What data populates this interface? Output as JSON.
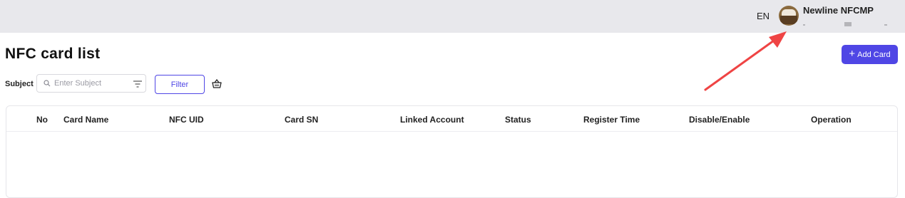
{
  "header": {
    "language": "EN",
    "user_name": "Newline NFCMP"
  },
  "page": {
    "title": "NFC card list",
    "add_button_label": "Add Card"
  },
  "filters": {
    "subject_label": "Subject",
    "search_placeholder": "Enter Subject",
    "filter_button_label": "Filter"
  },
  "table": {
    "columns": [
      "No",
      "Card Name",
      "NFC UID",
      "Card SN",
      "Linked Account",
      "Status",
      "Register Time",
      "Disable/Enable",
      "Operation"
    ],
    "rows": []
  },
  "colors": {
    "accent": "#4f46e5",
    "annotation_arrow": "#ef4444",
    "topbar": "#e8e8ec"
  },
  "icons": [
    "user-avatar-icon",
    "plus-icon",
    "search-icon",
    "filter-lines-icon",
    "basket-icon"
  ]
}
